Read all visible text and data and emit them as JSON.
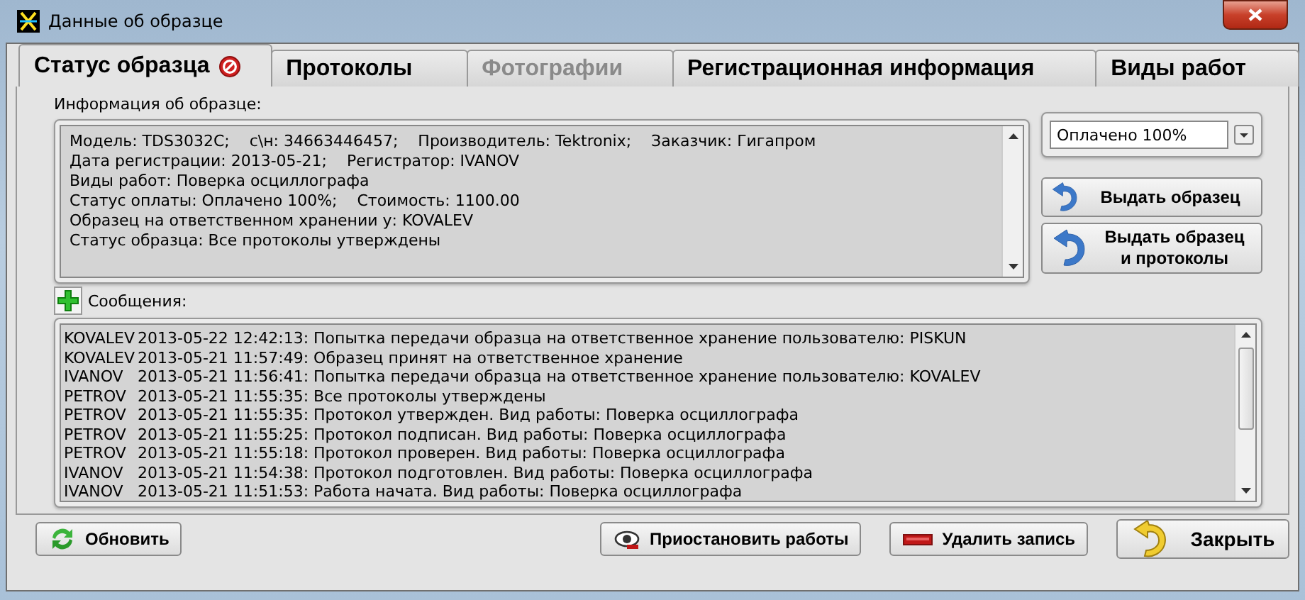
{
  "window": {
    "title": "Данные об образце"
  },
  "tabs": [
    {
      "label": "Статус образца",
      "selected": true,
      "disabled": false,
      "status_icon": true
    },
    {
      "label": "Протоколы",
      "selected": false,
      "disabled": false,
      "status_icon": false
    },
    {
      "label": "Фотографии",
      "selected": false,
      "disabled": true,
      "status_icon": false
    },
    {
      "label": "Регистрационная информация",
      "selected": false,
      "disabled": false,
      "status_icon": false
    },
    {
      "label": "Виды работ",
      "selected": false,
      "disabled": false,
      "status_icon": false
    }
  ],
  "info": {
    "label": "Информация об образце:",
    "lines": [
      "Модель: TDS3032C;    с\\н: 34663446457;    Производитель: Tektronix;    Заказчик: Гигапром",
      "Дата регистрации: 2013-05-21;    Регистратор: IVANOV",
      "Виды работ: Поверка осциллографа",
      "Статус оплаты: Оплачено 100%;    Стоимость: 1100.00",
      "Образец на ответственном хранении у: KOVALEV",
      "Статус образца: Все протоколы утверждены"
    ]
  },
  "payment_select": {
    "value": "Оплачено 100%"
  },
  "side_buttons": [
    "Выдать образец",
    "Выдать образец\nи протоколы"
  ],
  "messages": {
    "label": "Сообщения:",
    "rows": [
      {
        "user": "KOVALEV",
        "text": "2013-05-22 12:42:13: Попытка передачи образца на ответственное хранение пользователю: PISKUN"
      },
      {
        "user": "KOVALEV",
        "text": "2013-05-21 11:57:49: Образец принят на ответственное хранение"
      },
      {
        "user": "IVANOV",
        "text": "2013-05-21 11:56:41: Попытка передачи образца на ответственное хранение пользователю: KOVALEV"
      },
      {
        "user": "PETROV",
        "text": "2013-05-21 11:55:35: Все протоколы утверждены"
      },
      {
        "user": "PETROV",
        "text": "2013-05-21 11:55:35: Протокол утвержден. Вид работы: Поверка осциллографа"
      },
      {
        "user": "PETROV",
        "text": "2013-05-21 11:55:25: Протокол подписан. Вид работы: Поверка осциллографа"
      },
      {
        "user": "PETROV",
        "text": "2013-05-21 11:55:18: Протокол проверен. Вид работы: Поверка осциллографа"
      },
      {
        "user": "IVANOV",
        "text": "2013-05-21 11:54:38: Протокол подготовлен. Вид работы: Поверка осциллографа"
      },
      {
        "user": "IVANOV",
        "text": "2013-05-21 11:51:53: Работа начата. Вид работы: Поверка осциллографа"
      }
    ]
  },
  "footer": [
    {
      "kind": "refresh",
      "label": "Обновить"
    },
    {
      "kind": "suspend",
      "label": "Приостановить работы"
    },
    {
      "kind": "delete",
      "label": "Удалить запись"
    },
    {
      "kind": "close",
      "label": "Закрыть"
    }
  ]
}
